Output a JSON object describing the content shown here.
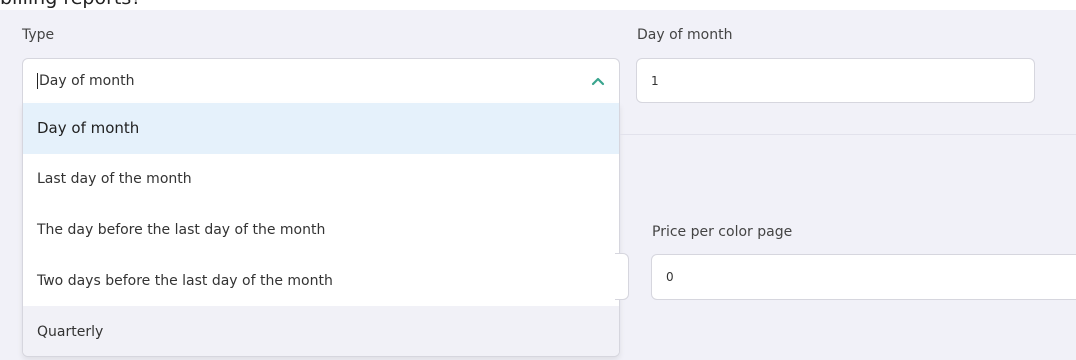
{
  "page_heading": "billing reports?",
  "type_field": {
    "label": "Type",
    "value": "Day of month",
    "expanded": true,
    "options": [
      "Day of month",
      "Last day of the month",
      "The day before the last day of the month",
      "Two days before the last day of the month",
      "Quarterly"
    ],
    "selected_option": "Day of month",
    "hovered_option": "Quarterly"
  },
  "day_of_month_field": {
    "label": "Day of month",
    "value": "1"
  },
  "color_price_field": {
    "label": "Price per color page",
    "value": "0"
  },
  "colors": {
    "background": "#f1f1f8",
    "selected_option": "#e5f1fb",
    "chevron": "#3aa58e"
  },
  "icons": {
    "dropdown_chevron": "chevron-up-icon"
  }
}
